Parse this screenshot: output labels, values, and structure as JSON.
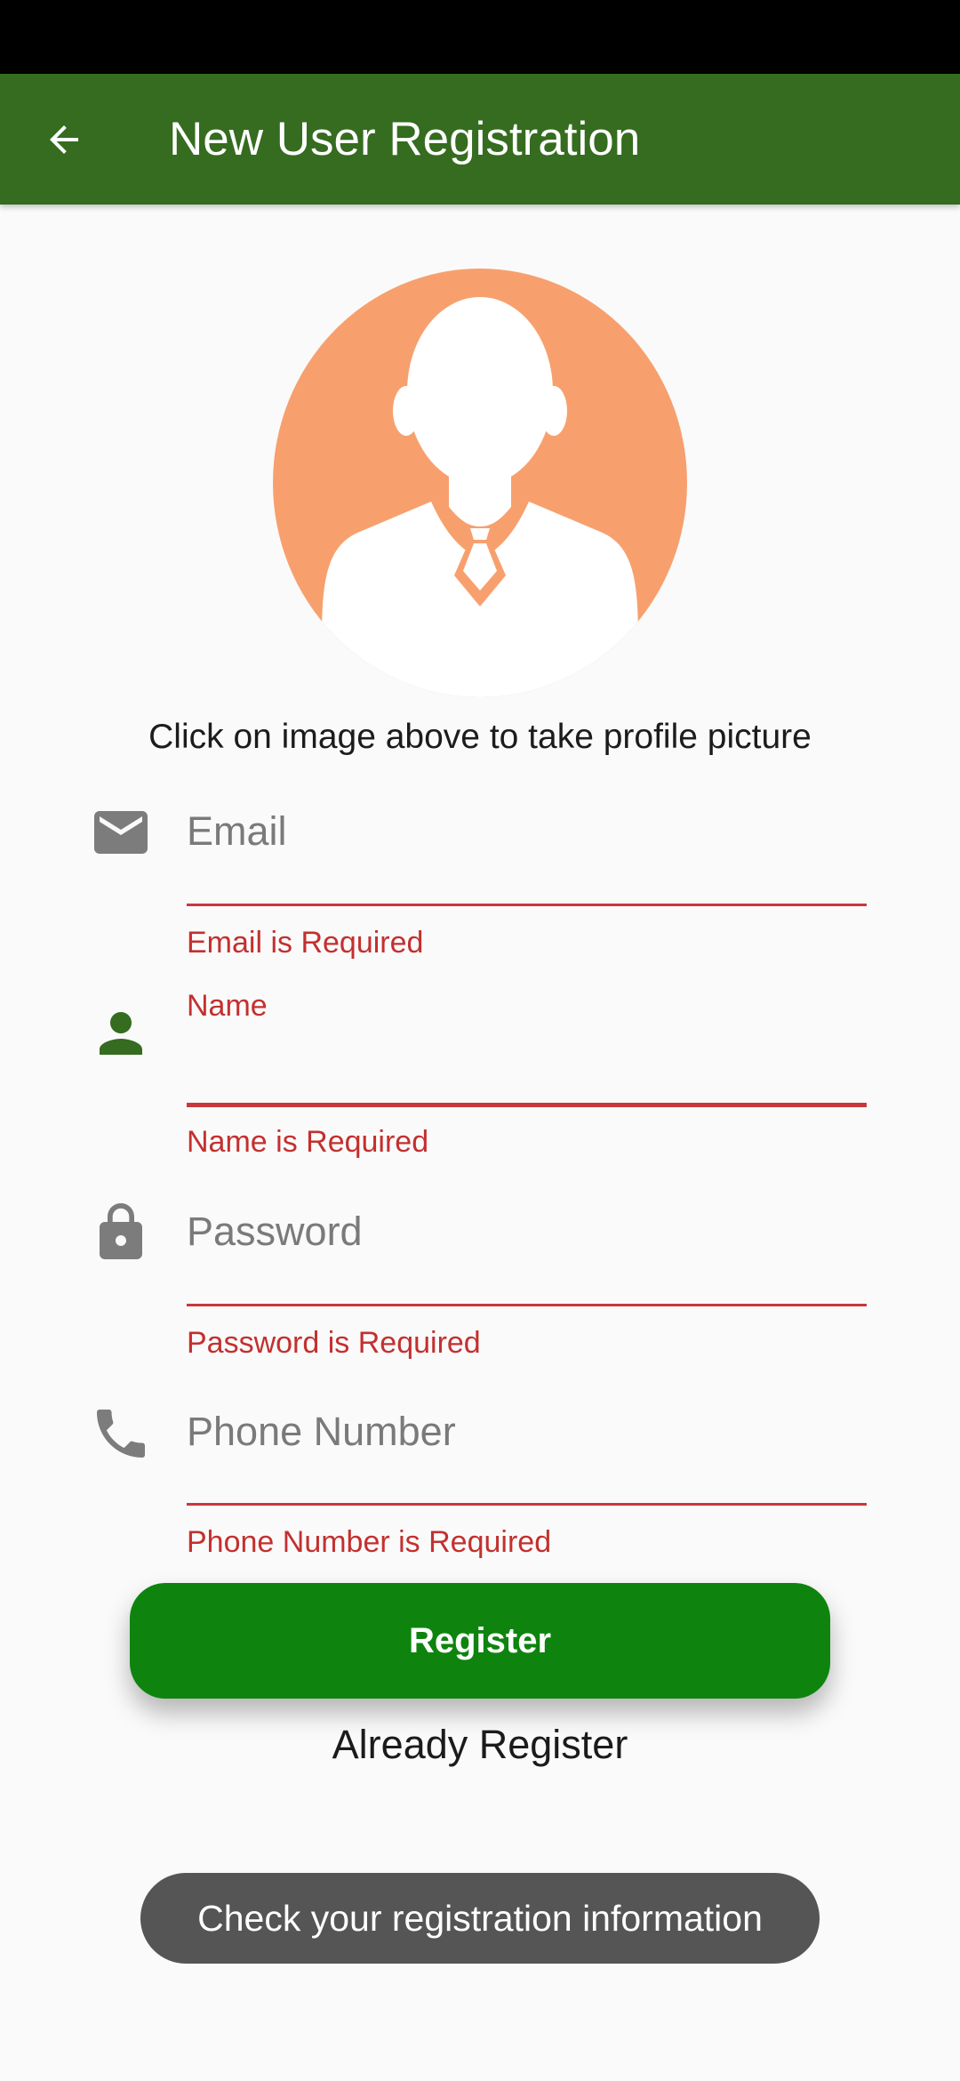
{
  "app_bar": {
    "title": "New User Registration",
    "back_icon": "arrow-back-icon",
    "color": "#356c1f"
  },
  "profile": {
    "avatar_icon": "person-silhouette-icon",
    "avatar_color": "#f7a06e",
    "caption": "Click on image above to take profile picture"
  },
  "form": {
    "email": {
      "icon": "mail-icon",
      "placeholder": "Email",
      "value": "",
      "error": "Email is Required"
    },
    "name": {
      "icon": "person-icon",
      "label": "Name",
      "value": "",
      "error": "Name is Required"
    },
    "password": {
      "icon": "lock-icon",
      "placeholder": "Password",
      "value": "",
      "error": "Password is Required"
    },
    "phone": {
      "icon": "phone-icon",
      "placeholder": "Phone Number",
      "value": "",
      "error": "Phone Number is Required"
    },
    "error_color": "#c3302f"
  },
  "actions": {
    "register_label": "Register",
    "register_color": "#0e840e",
    "login_link": "Already Register"
  },
  "snackbar": {
    "message": "Check your registration information"
  }
}
